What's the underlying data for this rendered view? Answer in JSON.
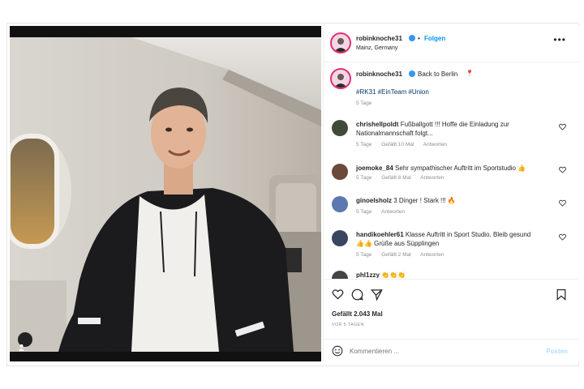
{
  "header": {
    "username": "robinknoche31",
    "follow_label": "Folgen",
    "location": "Mainz, Germany"
  },
  "caption": {
    "username": "robinknoche31",
    "text": "Back to Berlin",
    "hashtags": "#RK31 #EinTeam #Union",
    "age": "5 Tage"
  },
  "comments": [
    {
      "username": "chrishellpoldt",
      "line1": "Fußballgott !!! Hoffe die Einladung zur",
      "line2": "Nationalmannschaft folgt...",
      "age": "5 Tage",
      "likes": "Gefällt 10 Mal",
      "reply": "Antworten"
    },
    {
      "username": "joemoke_84",
      "line1": "Sehr sympathischer Auftritt im Sportstudio 👍",
      "line2": "",
      "age": "5 Tage",
      "likes": "Gefällt 8 Mal",
      "reply": "Antworten"
    },
    {
      "username": "ginoelsholz",
      "line1": "3 Dinger ! Stark !!! 🔥",
      "line2": "",
      "age": "5 Tage",
      "likes": "",
      "reply": "Antworten"
    },
    {
      "username": "handikoehler61",
      "line1": "Klasse Auftritt in Sport Studio. Bleib gesund",
      "line2": "👍👍 Grüße aus Süpplingen",
      "age": "5 Tage",
      "likes": "Gefällt 2 Mal",
      "reply": "Antworten"
    },
    {
      "username": "phl1zzy",
      "line1": "👏👏👏",
      "line2": ""
    }
  ],
  "actions": {
    "likes": "Gefällt 2.043 Mal",
    "date": "VOR 5 TAGEN"
  },
  "composer": {
    "placeholder": "Kommentieren ...",
    "post_label": "Posten"
  },
  "colors": {
    "accent": "#0095f6",
    "verified": "#3897f0",
    "muted": "#8e8e8e"
  }
}
